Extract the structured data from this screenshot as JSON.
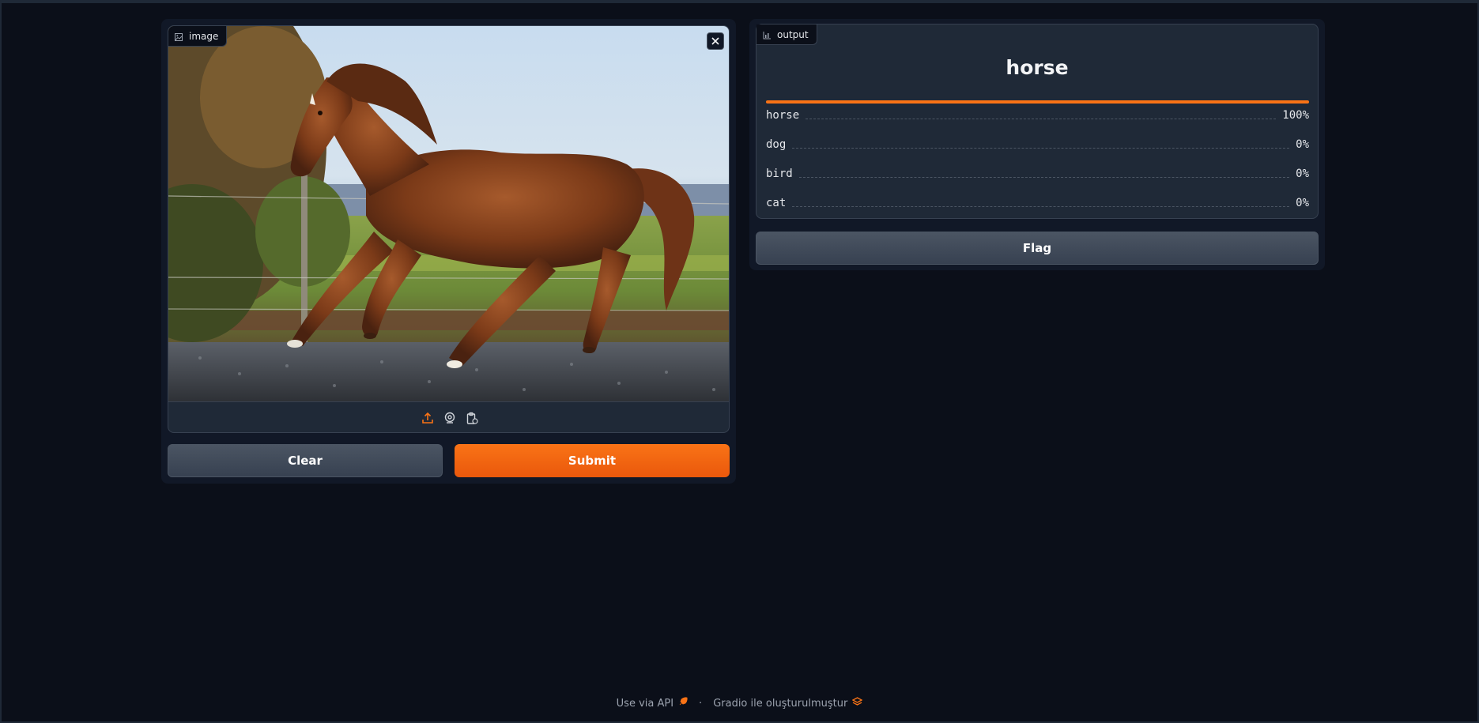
{
  "input": {
    "label": "image",
    "icon": "image-icon",
    "close_icon": "close-icon",
    "tools": [
      "upload-icon",
      "webcam-icon",
      "clipboard-icon"
    ]
  },
  "buttons": {
    "clear": "Clear",
    "submit": "Submit",
    "flag": "Flag"
  },
  "output": {
    "label": "output",
    "icon": "chart-icon",
    "top_label": "horse",
    "confidences": [
      {
        "label": "horse",
        "value": "100%",
        "fraction": 1.0
      },
      {
        "label": "dog",
        "value": "0%",
        "fraction": 0.0
      },
      {
        "label": "bird",
        "value": "0%",
        "fraction": 0.0
      },
      {
        "label": "cat",
        "value": "0%",
        "fraction": 0.0
      }
    ]
  },
  "footer": {
    "api_link": "Use via API",
    "separator": "·",
    "built_with": "Gradio ile oluşturulmuştur"
  },
  "colors": {
    "accent": "#f97316",
    "background": "#0b0f19",
    "panel": "#111827",
    "block": "#1f2937"
  }
}
